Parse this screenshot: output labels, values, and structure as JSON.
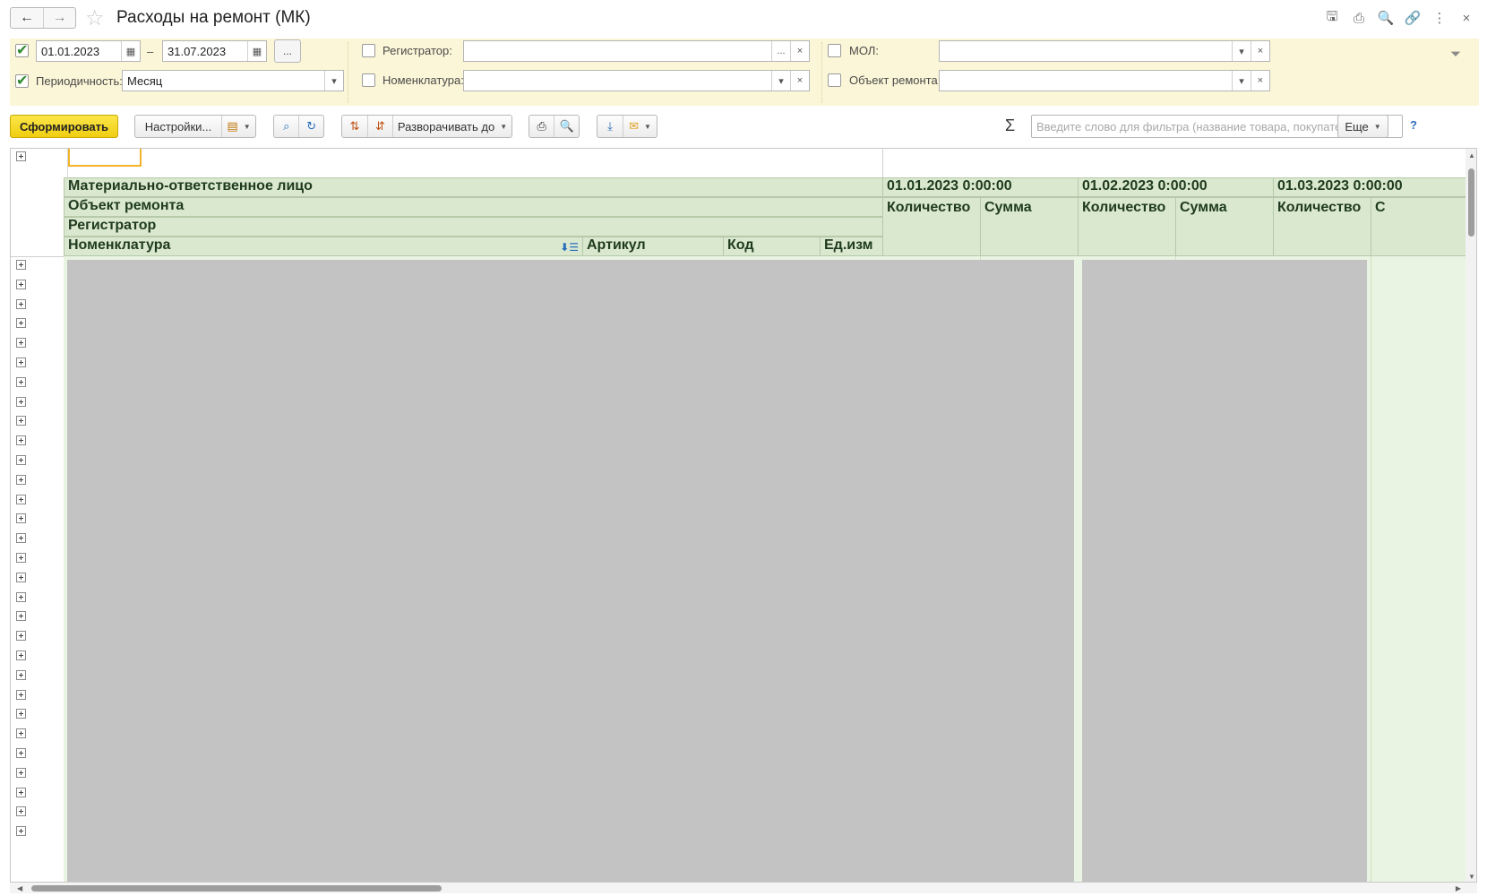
{
  "window": {
    "title": "Расходы на ремонт (МК)",
    "back_icon": "←",
    "forward_icon": "→",
    "favorite_icon": "☆",
    "actions": [
      {
        "name": "save-icon",
        "glyph": "🖫"
      },
      {
        "name": "print-icon",
        "glyph": "⎙"
      },
      {
        "name": "preview-icon",
        "glyph": "🔍"
      },
      {
        "name": "link-icon",
        "glyph": "🔗"
      },
      {
        "name": "more-icon",
        "glyph": "⋮"
      },
      {
        "name": "close-icon",
        "glyph": "×"
      }
    ]
  },
  "filters": {
    "date_from": "01.01.2023",
    "date_to": "31.07.2023",
    "date_dash": "–",
    "period_btn": "...",
    "periodicity_label": "Периодичность:",
    "periodicity_value": "Месяц",
    "registrar_label": "Регистратор:",
    "registrar_value": "",
    "nomenclature_label": "Номенклатура:",
    "nomenclature_value": "",
    "mol_label": "МОЛ:",
    "mol_value": "",
    "repair_object_label": "Объект ремонта:",
    "repair_object_value": "",
    "date_from_checked": true,
    "periodicity_checked": true,
    "registrar_checked": false,
    "nomenclature_checked": false,
    "mol_checked": false,
    "repair_object_checked": false
  },
  "toolbar": {
    "generate_label": "Сформировать",
    "settings_label": "Настройки...",
    "expand_label": "Разворачивать до",
    "more_label": "Еще",
    "sigma": "Σ",
    "search_placeholder": "Введите слово для фильтра (название товара, покупателя и пр.)",
    "help": "?"
  },
  "report": {
    "row_headers": [
      "Материально-ответственное лицо",
      "Объект ремонта",
      "Регистратор"
    ],
    "columns": {
      "nomenclature": "Номенклатура",
      "article": "Артикул",
      "code": "Код",
      "unit": "Ед.изм"
    },
    "periods": [
      {
        "date": "01.01.2023 0:00:00",
        "qty": "Количество",
        "sum": "Сумма"
      },
      {
        "date": "01.02.2023 0:00:00",
        "qty": "Количество",
        "sum": "Сумма"
      },
      {
        "date": "01.03.2023 0:00:00",
        "qty": "Количество",
        "sum": "С"
      }
    ],
    "expandable_rows": 30
  },
  "colors": {
    "accent_yellow": "#f0ce10",
    "filter_bg": "#fbf6d7",
    "header_green": "#d9e8cf",
    "masked_gray": "#c3c3c3"
  }
}
